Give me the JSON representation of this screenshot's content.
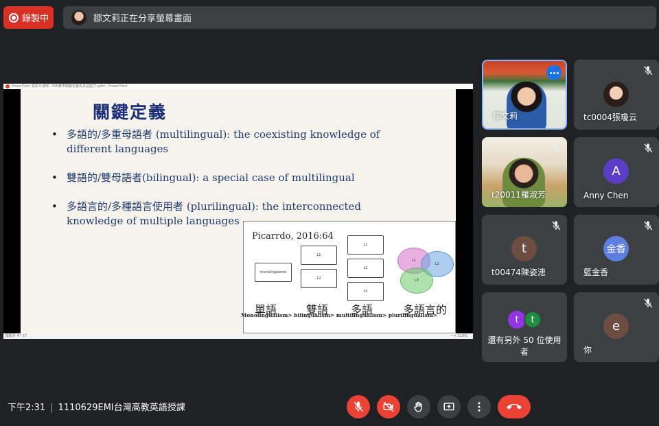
{
  "recording": {
    "label": "錄製中",
    "color": "#d93025"
  },
  "share_banner": {
    "text": "鄒文莉正在分享螢幕畫面"
  },
  "presentation": {
    "window_title": "PowerPoint 投影片放映 - EMI教學關鍵定義與多語能力.pptx - PowerPoint",
    "status_text": "投影片 4 / 17",
    "zoom_text": "—+ 110%",
    "slide": {
      "title": "關鍵定義",
      "bullets": [
        "多語的/多重母語者 (multilingual): the coexisting knowledge of different languages",
        "雙語的/雙母語者(bilingual): a special case of multilingual",
        "多語言的/多種語言使用者 (plurilingual): the interconnected knowledge of multiple languages"
      ],
      "diagram": {
        "citation": "Picarrdo, 2016:64",
        "mono_box": "monolinguisme",
        "bi_boxes": [
          "L1",
          "L2"
        ],
        "multi_boxes": [
          "L1",
          "L2",
          "L3"
        ],
        "venn": [
          "L1",
          "L2",
          "L3"
        ],
        "labels": [
          "單語",
          "雙語",
          "多語",
          "多語言的"
        ],
        "caption": "Monolingualism> bilingualism> multilingualism> plurilingualism>"
      }
    }
  },
  "participants": [
    {
      "name": "鄒文莉",
      "type": "video",
      "active": true
    },
    {
      "name": "tc0004張瓊云",
      "type": "photo",
      "muted": true
    },
    {
      "name": "t20011羅淑芳",
      "type": "video",
      "muted": true
    },
    {
      "name": "Anny Chen",
      "type": "letter",
      "initial": "A",
      "color": "#5b3ec8",
      "muted": true
    },
    {
      "name": "t00474陳姿漶",
      "type": "letter",
      "initial": "t",
      "color": "#6d4c41",
      "muted": true
    },
    {
      "name": "藍金香",
      "type": "letter",
      "initial": "金香",
      "color": "#5e7ee0",
      "muted": true
    },
    {
      "name": "你",
      "type": "letter",
      "initial": "e",
      "color": "#6d4c41",
      "muted": true
    }
  ],
  "others": {
    "label": "還有另外 50 位使用者",
    "initials": [
      "t",
      "t"
    ],
    "colors": [
      "#9334e6",
      "#1e8e3e"
    ]
  },
  "bottom_bar": {
    "time": "下午2:31",
    "meeting_title": "1110629EMI台灣高教英語授課"
  },
  "controls": [
    {
      "icon": "mic-off-icon",
      "state": "off"
    },
    {
      "icon": "camera-off-icon",
      "state": "off"
    },
    {
      "icon": "raise-hand-icon"
    },
    {
      "icon": "present-screen-icon"
    },
    {
      "icon": "more-options-icon"
    },
    {
      "icon": "hang-up-icon"
    }
  ],
  "colors": {
    "background": "#202124",
    "tile": "#3c4043",
    "accent": "#8ab4f8",
    "danger": "#ea4335"
  }
}
